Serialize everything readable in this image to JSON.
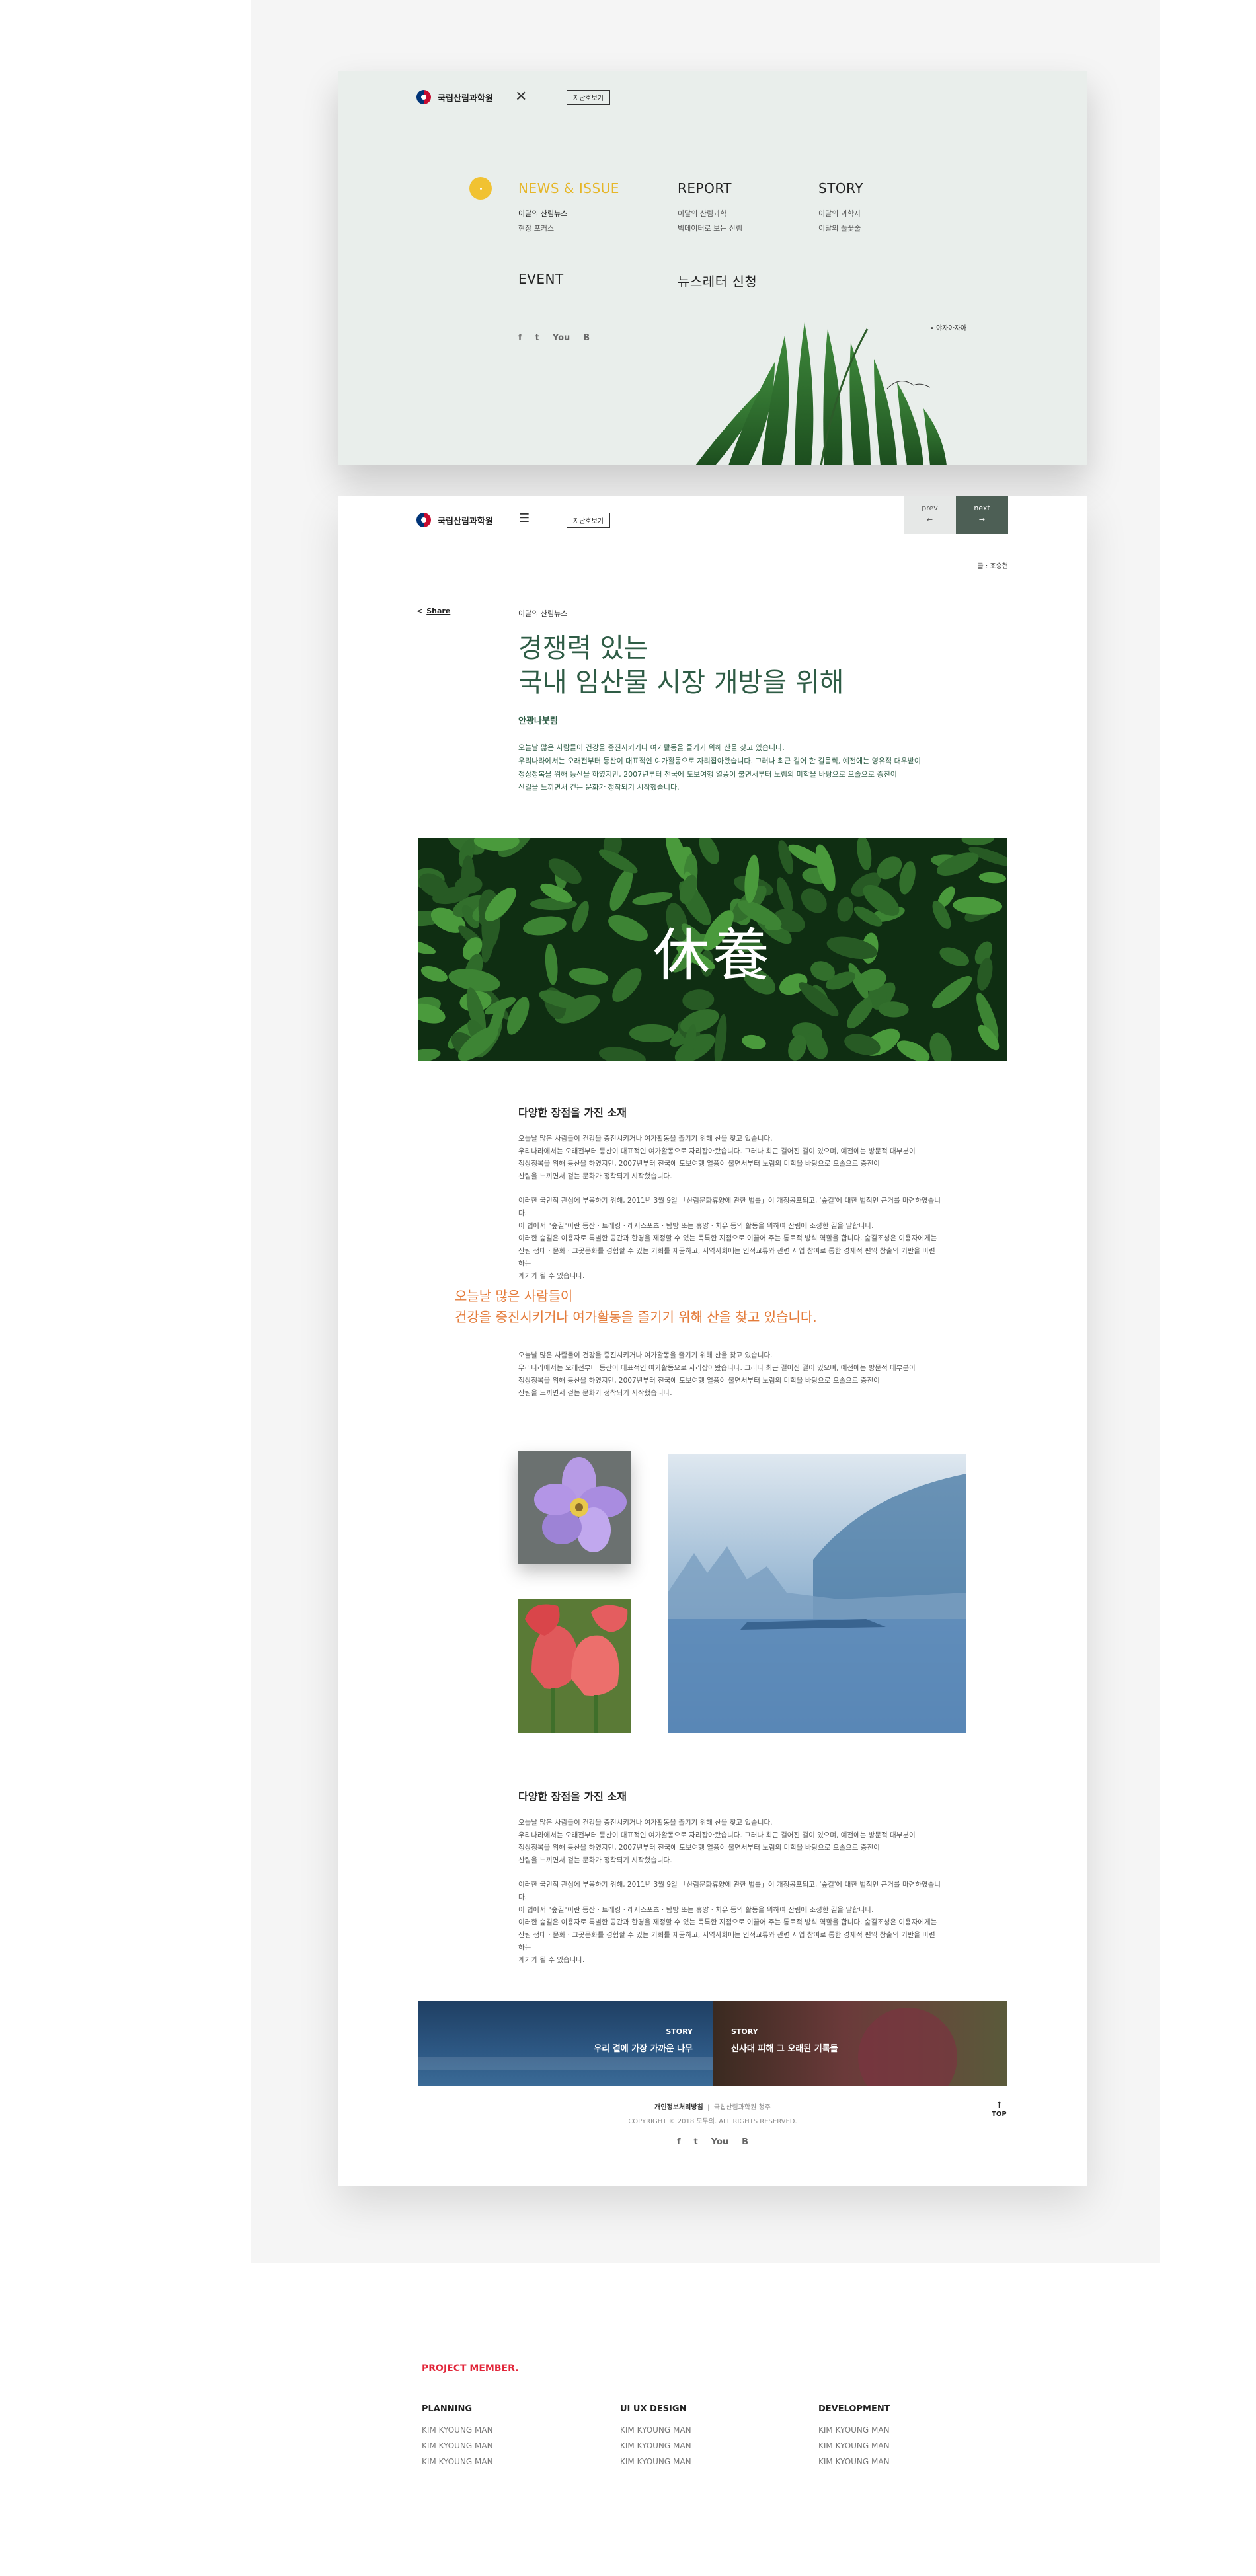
{
  "brand": {
    "logo_text": "국립산림과학원"
  },
  "menu": {
    "kids_button": "지난호보기",
    "sections": [
      {
        "title": "NEWS & ISSUE",
        "items": [
          "이달의 산림뉴스",
          "현장 포커스"
        ]
      },
      {
        "title": "REPORT",
        "items": [
          "이달의 산림과학",
          "빅데이터로 보는 산림"
        ]
      },
      {
        "title": "STORY",
        "items": [
          "이달의 과학자",
          "이달의 풀꽃술"
        ]
      },
      {
        "title": "EVENT",
        "items": []
      },
      {
        "title": "뉴스레터 신청",
        "items": []
      }
    ],
    "sns": [
      "f",
      "t",
      "You",
      "B"
    ],
    "plant_caption": "야자아자아"
  },
  "article": {
    "kids_button": "지난호보기",
    "prev": {
      "label": "prev",
      "arrow": "←"
    },
    "next": {
      "label": "next",
      "arrow": "→"
    },
    "author": "글 : 조승현",
    "share_label": "Share",
    "category": "이달의 산림뉴스",
    "headline_line1": "경쟁력 있는",
    "headline_line2": "국내 임산물 시장 개방을 위해",
    "subheading": "안광나붓림",
    "lead": [
      "오늘날 많은 사람들이 건강을 증진시키거나 여가활동을 즐기기 위해 산을 찾고 있습니다.",
      "우리나라에서는 오래전부터 등산이 대표적인 여가활동으로 자리잡아왔습니다. 그러나 최근 걸어 한 걸음씩, 예전에는 영유적 대우받이",
      "정상정복을 위해 등산을 하였지만, 2007년부터 전국에 도보여행 열풍이 불면서부터 노림의 미학을 바탕으로 오솔으로 증진이",
      "산길을 느끼면서 걷는 문화가 정착되기 시작했습니다."
    ],
    "hero_text": "休養",
    "section1": {
      "title": "다양한 장점을 가진 소재",
      "para1": [
        "오늘날 많은 사람들이 건강을 증진시키거나 여가활동을 즐기기 위해 산을 찾고 있습니다.",
        "우리나라에서는 오래전부터 등산이 대표적인 여가활동으로 자리잡아왔습니다. 그러나 최근 걸어진 걸이 있으며, 예전에는 방문적 대부분이",
        "정상정복을 위해 등산을 하였지만, 2007년부터 전국에 도보여행 열풍이 불면서부터 노림의 미학을 바탕으로 오솔으로 증진이",
        "산림을 느끼면서 걷는 문화가 정착되기 시작했습니다."
      ],
      "para2": [
        "이러한 국민적 관심에 부응하기 위해, 2011년 3월 9일 「산림문화휴양에 관한 법률」이 개정공포되고, '숲길'에 대한 법적인 근거를 마련하였습니다.",
        "이 법에서 \"숲길\"이란 등산 · 트레킹 · 레저스포츠 · 탐방 또는 휴양 · 치유 등의 활동을 위하여 산림에 조성한 길을 말합니다.",
        "이러한 숲길은 이용자로 특별한 공간과 한경을 제정할 수 있는 독특한 지점으로 이끌어 주는 통로적 방식 역할을 합니다. 숲길조성은 이용자에게는",
        "산림 생태 · 문화 · 그곳문화를 경험할 수 있는 기회를 제공하고, 지역사회에는 인적교류와 관련 사업 참여로 통한 경제적 편익 창출의 기반을 마련하는",
        "계기가 될 수 있습니다."
      ]
    },
    "quote_line1": "오늘날 많은 사람들이",
    "quote_line2": "건강을 증진시키거나 여가활동을 즐기기 위해 산을 찾고 있습니다.",
    "para_after_quote": [
      "오늘날 많은 사람들이 건강을 증진시키거나 여가활동을 즐기기 위해 산을 찾고 있습니다.",
      "우리나라에서는 오래전부터 등산이 대표적인 여가활동으로 자리잡아왔습니다. 그러나 최근 걸어진 걸이 있으며, 예전에는 방문적 대부분이",
      "정상정복을 위해 등산을 하였지만, 2007년부터 전국에 도보여행 열풍이 불면서부터 노림의 미학을 바탕으로 오솔으로 증진이",
      "산림을 느끼면서 걷는 문화가 정착되기 시작했습니다."
    ],
    "section2": {
      "title": "다양한 장점을 가진 소재",
      "para1": [
        "오늘날 많은 사람들이 건강을 증진시키거나 여가활동을 즐기기 위해 산을 찾고 있습니다.",
        "우리나라에서는 오래전부터 등산이 대표적인 여가활동으로 자리잡아왔습니다. 그러나 최근 걸어진 걸이 있으며, 예전에는 방문적 대부분이",
        "정상정복을 위해 등산을 하였지만, 2007년부터 전국에 도보여행 열풍이 불면서부터 노림의 미학을 바탕으로 오솔으로 증진이",
        "산림을 느끼면서 걷는 문화가 정착되기 시작했습니다."
      ],
      "para2": [
        "이러한 국민적 관심에 부응하기 위해, 2011년 3월 9일 「산림문화휴양에 관한 법률」이 개정공포되고, '숲길'에 대한 법적인 근거를 마련하였습니다.",
        "이 법에서 \"숲길\"이란 등산 · 트레킹 · 레저스포츠 · 탐방 또는 휴양 · 치유 등의 활동을 위하여 산림에 조성한 길을 말합니다.",
        "이러한 숲길은 이용자로 특별한 공간과 한경을 제정할 수 있는 독특한 지점으로 이끌어 주는 통로적 방식 역할을 합니다. 숲길조성은 이용자에게는",
        "산림 생태 · 문화 · 그곳문화를 경험할 수 있는 기회를 제공하고, 지역사회에는 인적교류와 관련 사업 참여로 통한 경제적 편익 창출의 기반을 마련하는",
        "계기가 될 수 있습니다."
      ]
    },
    "stories": [
      {
        "label": "STORY",
        "title": "우리 곁에 가장 가까운 나무"
      },
      {
        "label": "STORY",
        "title": "신사대 피해 그 오래된 기록들"
      }
    ],
    "footer": {
      "privacy": "개인정보처리방침",
      "address": "국립산림과학원 청주",
      "copyright": "COPYRIGHT © 2018 모두의. ALL RIGHTS RESERVED.",
      "top_label": "TOP",
      "sns": [
        "f",
        "t",
        "You",
        "B"
      ]
    }
  },
  "members": {
    "title": "PROJECT MEMBER.",
    "columns": [
      {
        "head": "PLANNING",
        "names": [
          "KIM KYOUNG MAN",
          "KIM KYOUNG MAN",
          "KIM KYOUNG MAN"
        ]
      },
      {
        "head": "UI UX DESIGN",
        "names": [
          "KIM KYOUNG MAN",
          "KIM KYOUNG MAN",
          "KIM KYOUNG MAN"
        ]
      },
      {
        "head": "DEVELOPMENT",
        "names": [
          "KIM KYOUNG MAN",
          "KIM KYOUNG MAN",
          "KIM KYOUNG MAN"
        ]
      }
    ]
  },
  "colors": {
    "accent_yellow": "#e6b628",
    "green_text": "#2e5c45",
    "orange_quote": "#e47b3a",
    "member_red": "#e2263a",
    "next_bg": "#4d5f55"
  }
}
